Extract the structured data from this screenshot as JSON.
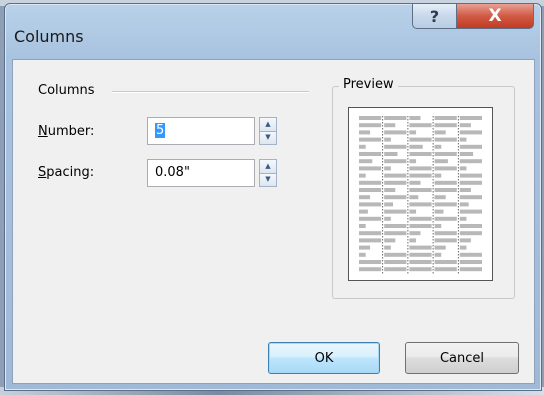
{
  "window": {
    "title": "Columns",
    "help_glyph": "?",
    "close_glyph": "X"
  },
  "columns_group": {
    "label": "Columns"
  },
  "number_field": {
    "label_mnemonic": "N",
    "label_rest": "umber:",
    "value": "5"
  },
  "spacing_field": {
    "label_mnemonic": "S",
    "label_rest": "pacing:",
    "value": "0.08\""
  },
  "preview": {
    "label": "Preview",
    "column_count": 5
  },
  "buttons": {
    "ok": "OK",
    "cancel": "Cancel"
  },
  "colors": {
    "selection": "#3399ff",
    "close_button": "#c23b22",
    "preview_bar": "#b8b8b8"
  }
}
